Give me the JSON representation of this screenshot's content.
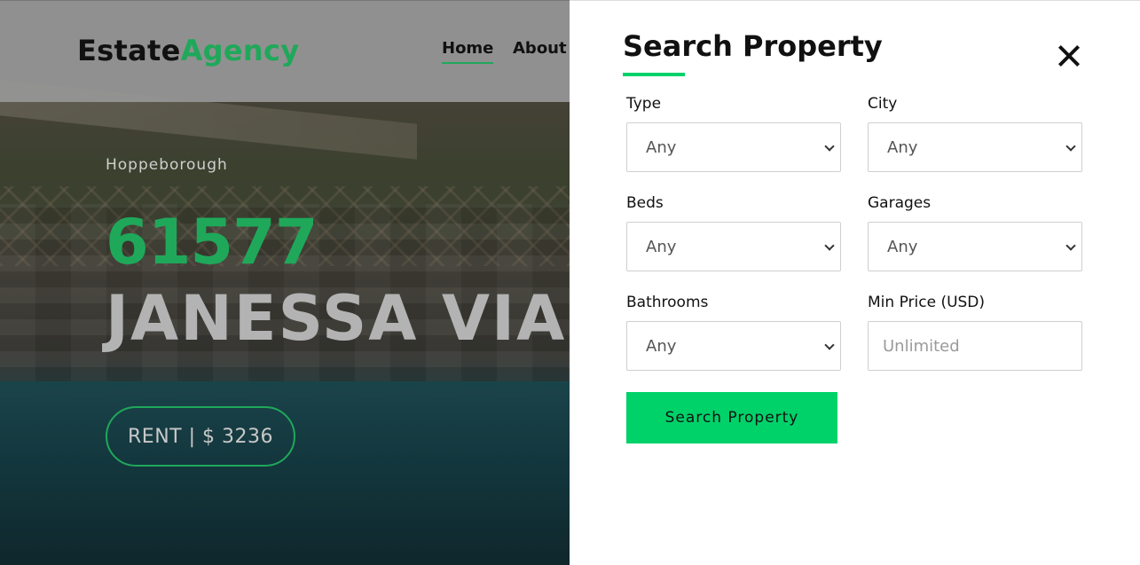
{
  "navbar": {
    "brand_part1": "Estate",
    "brand_part2": "Agency",
    "links": [
      {
        "label": "Home",
        "active": true
      },
      {
        "label": "About",
        "active": false
      }
    ]
  },
  "hero": {
    "city": "Hoppeborough",
    "number": "61577",
    "street": "JANESSA VIA",
    "rent_button": "RENT | $ 3236"
  },
  "search_panel": {
    "title": "Search Property",
    "close_icon": "close-icon",
    "fields": {
      "type": {
        "label": "Type",
        "value": "Any"
      },
      "city": {
        "label": "City",
        "value": "Any"
      },
      "beds": {
        "label": "Beds",
        "value": "Any"
      },
      "garages": {
        "label": "Garages",
        "value": "Any"
      },
      "bathrooms": {
        "label": "Bathrooms",
        "value": "Any"
      },
      "min_price": {
        "label": "Min Price (USD)",
        "placeholder": "Unlimited"
      }
    },
    "submit_label": "Search Property"
  },
  "colors": {
    "brand_green": "#1fa85a",
    "accent_green": "#00d26a",
    "panel_bg": "#ffffff"
  }
}
